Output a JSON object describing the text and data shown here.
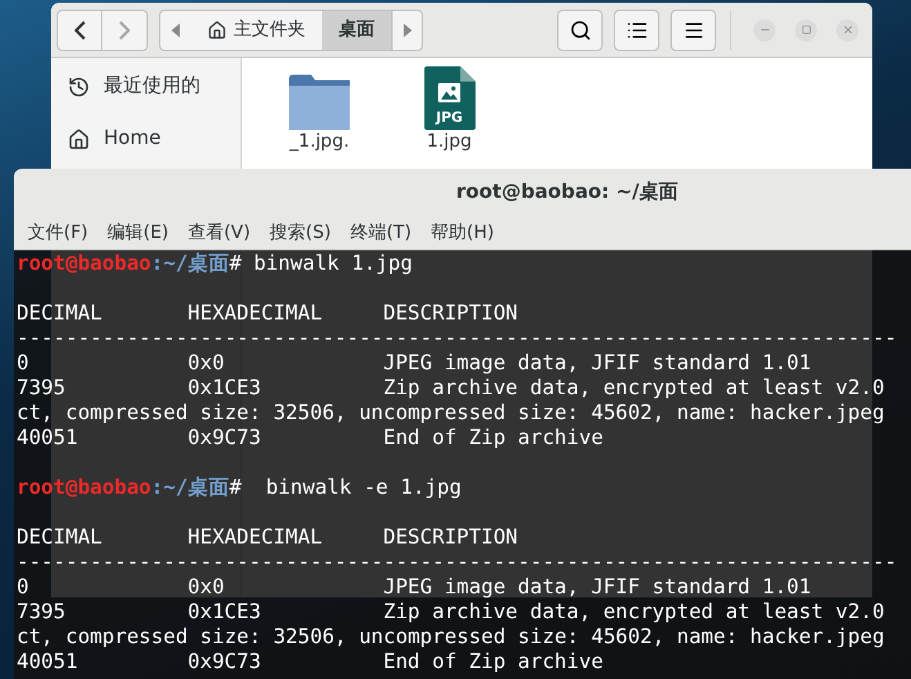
{
  "file_manager": {
    "nav": [
      {
        "kind": "back",
        "disabled": false
      },
      {
        "kind": "forward",
        "disabled": true
      }
    ],
    "path": [
      {
        "label": "主文件夹",
        "kind": "home",
        "selected": false
      },
      {
        "label": "桌面",
        "kind": "folder",
        "selected": true
      }
    ],
    "sidebar": [
      {
        "label": "最近使用的"
      },
      {
        "label": "Home"
      }
    ],
    "files": [
      {
        "name": "_1.jpg.",
        "kind": "folder"
      },
      {
        "name": "1.jpg",
        "kind": "jpg",
        "badge": "JPG"
      }
    ]
  },
  "terminal": {
    "title": "root@baobao: ~/桌面",
    "menu": [
      "文件(F)",
      "编辑(E)",
      "查看(V)",
      "搜索(S)",
      "终端(T)",
      "帮助(H)"
    ],
    "lines": [
      {
        "kind": "prompt",
        "user": "root@baobao",
        "path": ":~/桌面",
        "symbol": "#",
        "command": " binwalk 1.jpg"
      },
      {
        "kind": "blank"
      },
      {
        "kind": "columns",
        "cells": [
          "DECIMAL",
          "HEXADECIMAL",
          "DESCRIPTION"
        ]
      },
      {
        "kind": "rule",
        "text": "------------------------------------------------------------------------"
      },
      {
        "kind": "row",
        "cells": [
          "0",
          "0x0",
          "JPEG image data, JFIF standard 1.01"
        ]
      },
      {
        "kind": "row",
        "cells": [
          "7395",
          "0x1CE3",
          "Zip archive data, encrypted at least v2.0"
        ]
      },
      {
        "kind": "wrap",
        "text": "ct, compressed size: 32506, uncompressed size: 45602, name: hacker.jpeg"
      },
      {
        "kind": "row",
        "cells": [
          "40051",
          "0x9C73",
          "End of Zip archive"
        ]
      },
      {
        "kind": "blank"
      },
      {
        "kind": "prompt",
        "user": "root@baobao",
        "path": ":~/桌面",
        "symbol": "#",
        "command": "  binwalk -e 1.jpg"
      },
      {
        "kind": "blank"
      },
      {
        "kind": "columns",
        "cells": [
          "DECIMAL",
          "HEXADECIMAL",
          "DESCRIPTION"
        ]
      },
      {
        "kind": "rule",
        "text": "------------------------------------------------------------------------"
      },
      {
        "kind": "row",
        "cells": [
          "0",
          "0x0",
          "JPEG image data, JFIF standard 1.01"
        ]
      },
      {
        "kind": "row",
        "cells": [
          "7395",
          "0x1CE3",
          "Zip archive data, encrypted at least v2.0"
        ]
      },
      {
        "kind": "wrap",
        "text": "ct, compressed size: 32506, uncompressed size: 45602, name: hacker.jpeg"
      },
      {
        "kind": "row",
        "cells": [
          "40051",
          "0x9C73",
          "End of Zip archive"
        ]
      }
    ]
  }
}
